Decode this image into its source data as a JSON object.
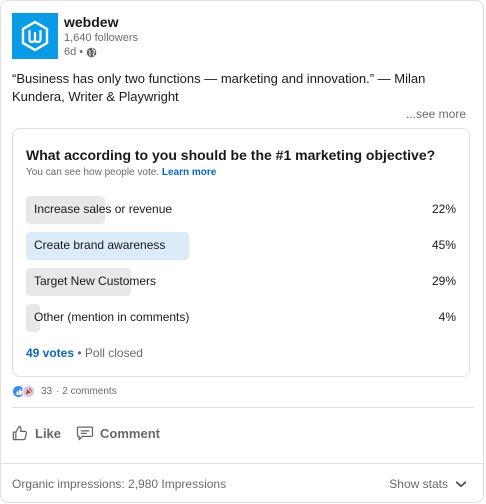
{
  "post": {
    "author": "webdew",
    "followers": "1,640 followers",
    "age": "6d •",
    "text": "“Business has only two functions — marketing and innovation.” — Milan Kundera, Writer & Playwright",
    "see_more": "...see more"
  },
  "poll": {
    "question": "What according to you should be the #1 marketing objective?",
    "subtitle": "You can see how people vote.",
    "learn_more": "Learn more",
    "options": [
      {
        "label": "Increase sales or revenue",
        "percent": "22%",
        "fill": 0.22,
        "selected": false
      },
      {
        "label": "Create brand awareness",
        "percent": "45%",
        "fill": 0.45,
        "selected": true
      },
      {
        "label": "Target New Customers",
        "percent": "29%",
        "fill": 0.29,
        "selected": false
      },
      {
        "label": "Other (mention in comments)",
        "percent": "4%",
        "fill": 0.04,
        "selected": false
      }
    ],
    "votes": "49 votes",
    "status": "• Poll closed"
  },
  "social": {
    "reactions": "33",
    "comments": "· 2 comments",
    "reaction_icons": [
      "like-icon",
      "celebrate-icon"
    ]
  },
  "actions": {
    "like": "Like",
    "comment": "Comment"
  },
  "footer": {
    "impressions": "Organic impressions: 2,980 Impressions",
    "show_stats": "Show stats"
  },
  "colors": {
    "brand": "#0a9be6",
    "link": "#0a66c2",
    "bar_default": "#e8e8e8",
    "bar_selected": "#dcebfa"
  }
}
